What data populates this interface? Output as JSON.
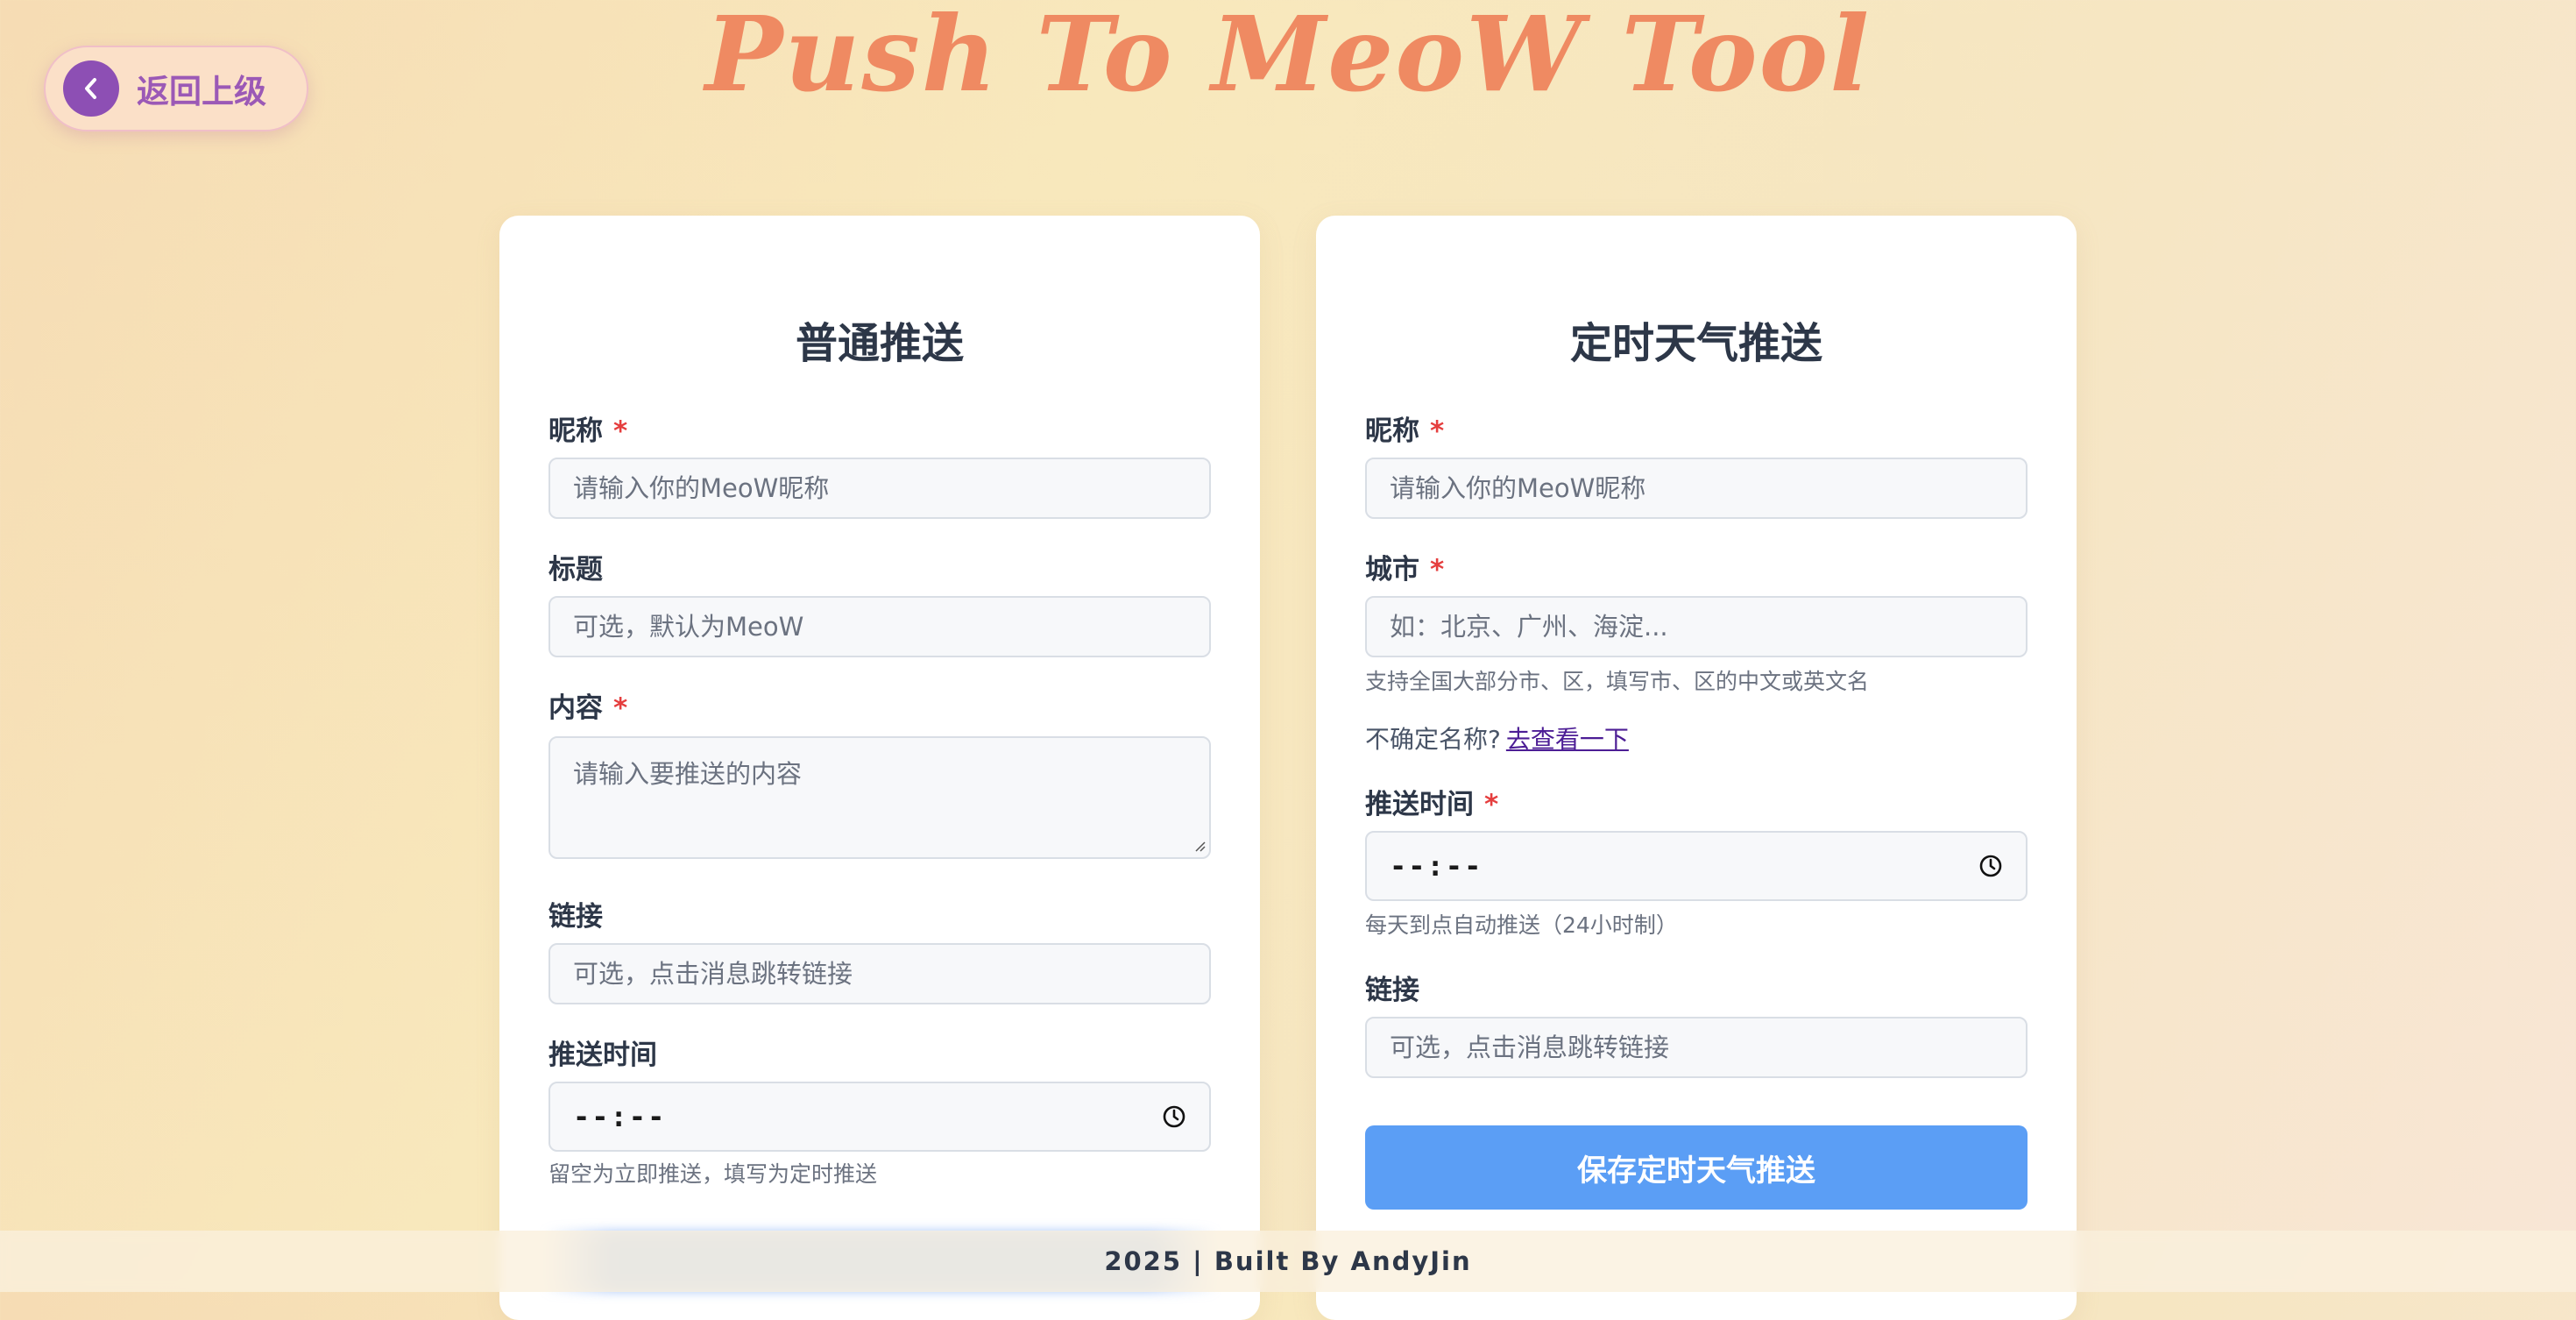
{
  "header": {
    "back_label": "返回上级",
    "app_title": "Push To MeoW Tool"
  },
  "normal_push": {
    "title": "普通推送",
    "nickname_label": "昵称",
    "nickname_required": "*",
    "nickname_placeholder": "请输入你的MeoW昵称",
    "title_label": "标题",
    "title_placeholder": "可选，默认为MeoW",
    "content_label": "内容",
    "content_required": "*",
    "content_placeholder": "请输入要推送的内容",
    "link_label": "链接",
    "link_placeholder": "可选，点击消息跳转链接",
    "time_label": "推送时间",
    "time_value": "--:--",
    "time_hint": "留空为立即推送，填写为定时推送"
  },
  "weather_push": {
    "title": "定时天气推送",
    "nickname_label": "昵称",
    "nickname_required": "*",
    "nickname_placeholder": "请输入你的MeoW昵称",
    "city_label": "城市",
    "city_required": "*",
    "city_placeholder": "如：北京、广州、海淀...",
    "city_hint": "支持全国大部分市、区，填写市、区的中文或英文名",
    "unsure_text": "不确定名称?",
    "unsure_link": "去查看一下",
    "time_label": "推送时间",
    "time_required": "*",
    "time_value": "--:--",
    "time_hint": "每天到点自动推送（24小时制）",
    "link_label": "链接",
    "link_placeholder": "可选，点击消息跳转链接",
    "save_button": "保存定时天气推送"
  },
  "footer": {
    "text": "2025 | Built By AndyJin"
  },
  "icons": {
    "back": "chevron-left-icon",
    "clock": "clock-icon"
  },
  "colors": {
    "accent_title": "#ef8a62",
    "back_purple": "#8d4fb4",
    "primary_button": "#5b9ef5",
    "required": "#e53e3e"
  }
}
